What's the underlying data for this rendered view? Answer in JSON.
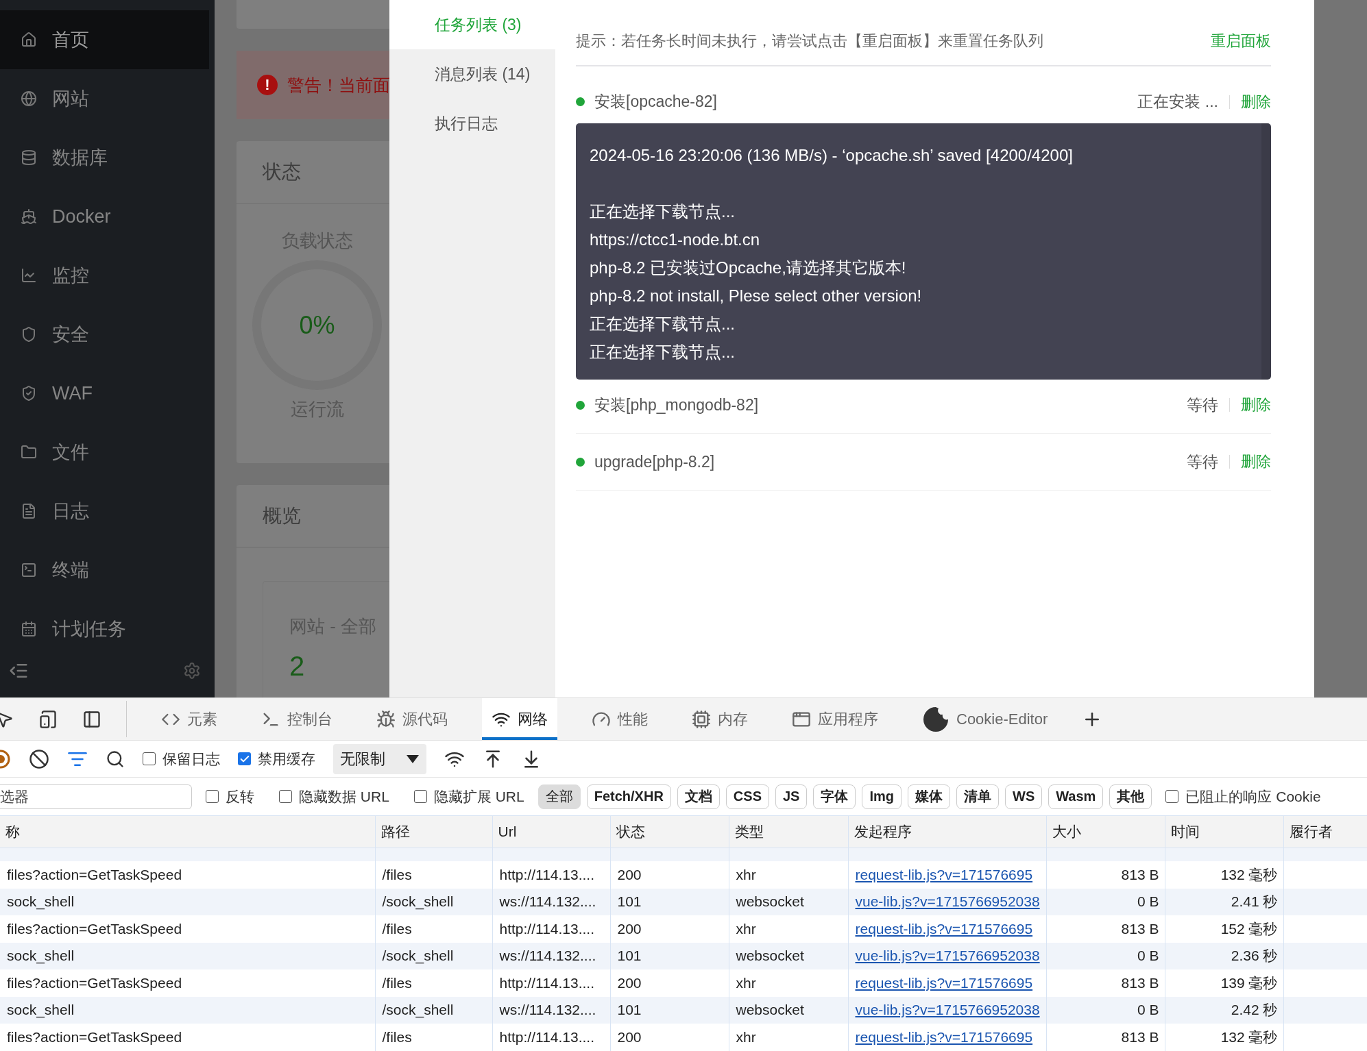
{
  "sidebar": {
    "items": [
      {
        "label": "首页",
        "selected": true
      },
      {
        "label": "网站",
        "selected": false
      },
      {
        "label": "数据库",
        "selected": false
      },
      {
        "label": "Docker",
        "selected": false
      },
      {
        "label": "监控",
        "selected": false
      },
      {
        "label": "安全",
        "selected": false
      },
      {
        "label": "WAF",
        "selected": false
      },
      {
        "label": "文件",
        "selected": false
      },
      {
        "label": "日志",
        "selected": false
      },
      {
        "label": "终端",
        "selected": false
      },
      {
        "label": "计划任务",
        "selected": false
      }
    ]
  },
  "background": {
    "warning_icon": "!",
    "warning": "警告！当前面",
    "status_title": "状态",
    "load_label": "负载状态",
    "load_value": "0%",
    "load_caption": "运行流",
    "overview_title": "概览",
    "site_label": "网站 - 全部",
    "site_count": "2"
  },
  "modal": {
    "nav": [
      {
        "label": "任务列表 (3)",
        "selected": true
      },
      {
        "label": "消息列表 (14)",
        "selected": false
      },
      {
        "label": "执行日志",
        "selected": false
      }
    ],
    "hint": "提示：若任务长时间未执行，请尝试点击【重启面板】来重置任务队列",
    "restart": "重启面板",
    "tasks": [
      {
        "name": "安装[opcache-82]",
        "status": "正在安装 ...",
        "delete": "删除",
        "log": [
          "2024-05-16 23:20:06 (136 MB/s) - ‘opcache.sh’ saved [4200/4200]",
          "正在选择下载节点...",
          "https://ctcc1-node.bt.cn",
          "php-8.2 已安装过Opcache,请选择其它版本!",
          "php-8.2 not install, Plese select other version!",
          "正在选择下载节点...",
          "正在选择下载节点..."
        ]
      },
      {
        "name": "安装[php_mongodb-82]",
        "status": "等待",
        "delete": "删除"
      },
      {
        "name": "upgrade[php-8.2]",
        "status": "等待",
        "delete": "删除"
      }
    ]
  },
  "devtools": {
    "tabs": [
      {
        "label": "元素",
        "selected": false
      },
      {
        "label": "控制台",
        "selected": false
      },
      {
        "label": "源代码",
        "selected": false
      },
      {
        "label": "网络",
        "selected": true
      },
      {
        "label": "性能",
        "selected": false
      },
      {
        "label": "内存",
        "selected": false
      },
      {
        "label": "应用程序",
        "selected": false
      },
      {
        "label": "Cookie-Editor",
        "selected": false
      }
    ],
    "preserve_log": {
      "label": "保留日志",
      "checked": false
    },
    "disable_cache": {
      "label": "禁用缓存",
      "checked": true
    },
    "throttle": "无限制",
    "filter": {
      "placeholder": "选器"
    },
    "options": [
      {
        "label": "反转",
        "checked": false
      },
      {
        "label": "隐藏数据 URL",
        "checked": false
      },
      {
        "label": "隐藏扩展 URL",
        "checked": false
      }
    ],
    "types": [
      {
        "label": "全部",
        "selected": true
      },
      {
        "label": "Fetch/XHR",
        "selected": false
      },
      {
        "label": "文档",
        "selected": false
      },
      {
        "label": "CSS",
        "selected": false
      },
      {
        "label": "JS",
        "selected": false
      },
      {
        "label": "字体",
        "selected": false
      },
      {
        "label": "Img",
        "selected": false
      },
      {
        "label": "媒体",
        "selected": false
      },
      {
        "label": "清单",
        "selected": false
      },
      {
        "label": "WS",
        "selected": false
      },
      {
        "label": "Wasm",
        "selected": false
      },
      {
        "label": "其他",
        "selected": false
      }
    ],
    "blocked_cookies": {
      "label": "已阻止的响应 Cookie",
      "checked": false
    },
    "table": {
      "columns": [
        "称",
        "路径",
        "Url",
        "状态",
        "类型",
        "发起程序",
        "大小",
        "时间",
        "履行者"
      ],
      "rows": [
        [
          "files?action=GetTaskSpeed",
          "/files",
          "http://114.13....",
          "200",
          "xhr",
          "request-lib.js?v=171576695",
          "813 B",
          "132  毫秒"
        ],
        [
          "sock_shell",
          "/sock_shell",
          "ws://114.132....",
          "101",
          "websocket",
          "vue-lib.js?v=1715766952038",
          "0 B",
          "2.41 秒"
        ],
        [
          "files?action=GetTaskSpeed",
          "/files",
          "http://114.13....",
          "200",
          "xhr",
          "request-lib.js?v=171576695",
          "813 B",
          "152  毫秒"
        ],
        [
          "sock_shell",
          "/sock_shell",
          "ws://114.132....",
          "101",
          "websocket",
          "vue-lib.js?v=1715766952038",
          "0 B",
          "2.36 秒"
        ],
        [
          "files?action=GetTaskSpeed",
          "/files",
          "http://114.13....",
          "200",
          "xhr",
          "request-lib.js?v=171576695",
          "813 B",
          "139  毫秒"
        ],
        [
          "sock_shell",
          "/sock_shell",
          "ws://114.132....",
          "101",
          "websocket",
          "vue-lib.js?v=1715766952038",
          "0 B",
          "2.42 秒"
        ],
        [
          "files?action=GetTaskSpeed",
          "/files",
          "http://114.13....",
          "200",
          "xhr",
          "request-lib.js?v=171576695",
          "813 B",
          "132  毫秒"
        ]
      ]
    }
  }
}
